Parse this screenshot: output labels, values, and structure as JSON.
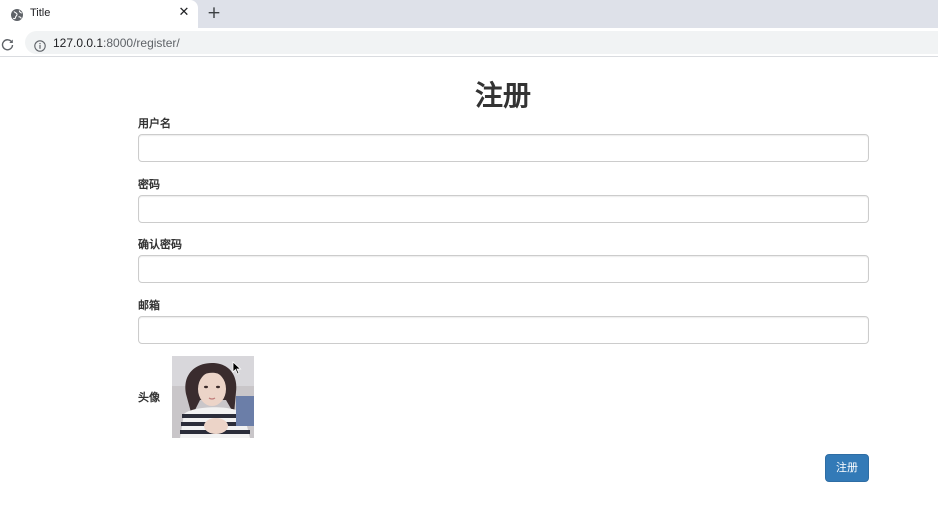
{
  "browser": {
    "tab": {
      "title": "Title",
      "close_glyph": "✕",
      "favicon": "globe-icon"
    },
    "new_tab_glyph": "+",
    "address": {
      "host": "127.0.0.1",
      "rest": ":8000/register/"
    }
  },
  "page": {
    "title": "注册",
    "fields": [
      {
        "label": "用户名",
        "value": ""
      },
      {
        "label": "密码",
        "value": ""
      },
      {
        "label": "确认密码",
        "value": ""
      },
      {
        "label": "邮箱",
        "value": ""
      }
    ],
    "avatar_label": "头像",
    "submit_label": "注册"
  },
  "colors": {
    "primary_button": "#337ab7",
    "tabbar": "#dee1e9",
    "text": "#333333"
  }
}
